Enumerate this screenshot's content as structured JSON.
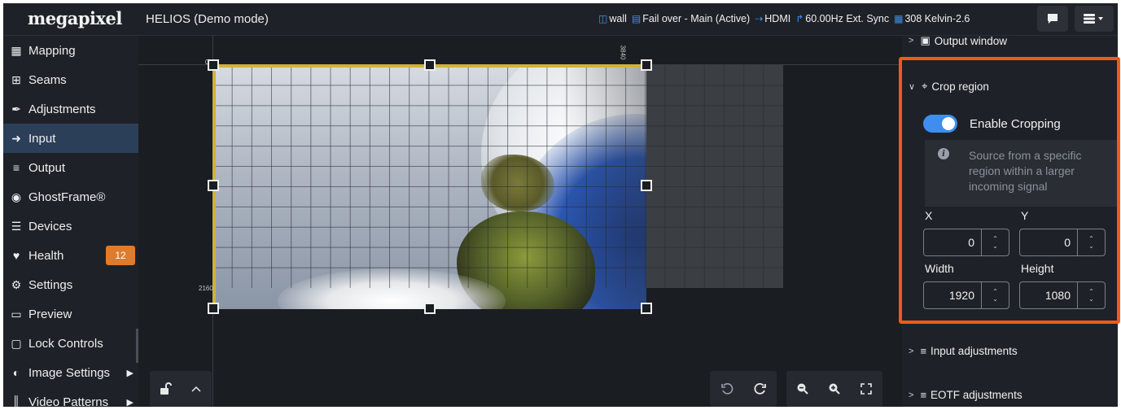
{
  "app": {
    "logo": "megapixel",
    "title": "HELIOS (Demo mode)"
  },
  "status_bar": [
    {
      "icon": "database-icon",
      "label": "wall"
    },
    {
      "icon": "server-icon",
      "label": "Fail over - Main (Active)"
    },
    {
      "icon": "input-arrow-icon",
      "label": "HDMI"
    },
    {
      "icon": "signal-pulse-icon",
      "label": "60.00Hz Ext. Sync"
    },
    {
      "icon": "grid-icon",
      "label": "308 Kelvin-2.6"
    }
  ],
  "toolbar_buttons": {
    "chat": "chat-icon",
    "database_menu": "database-menu-icon"
  },
  "sidebar": {
    "items": [
      {
        "label": "Mapping",
        "icon": "table-icon"
      },
      {
        "label": "Seams",
        "icon": "plus-square-icon"
      },
      {
        "label": "Adjustments",
        "icon": "brush-icon"
      },
      {
        "label": "Input",
        "icon": "sign-in-icon",
        "active": true
      },
      {
        "label": "Output",
        "icon": "sliders-icon"
      },
      {
        "label": "GhostFrame®",
        "icon": "ghostframe-icon"
      },
      {
        "label": "Devices",
        "icon": "list-icon"
      },
      {
        "label": "Health",
        "icon": "heart-pulse-icon",
        "badge": "12"
      },
      {
        "label": "Settings",
        "icon": "cogs-icon"
      },
      {
        "label": "Preview",
        "icon": "monitor-icon"
      },
      {
        "label": "Lock Controls",
        "icon": "unlock-icon"
      },
      {
        "label": "Image Settings",
        "icon": "contrast-icon",
        "submenu": true
      },
      {
        "label": "Video Patterns",
        "icon": "barcode-icon",
        "submenu": true
      }
    ]
  },
  "canvas": {
    "ruler_top_left": "0",
    "ruler_top_right": "3840",
    "ruler_left_bottom": "2160"
  },
  "panel": {
    "output_window": "Output window",
    "crop_region": "Crop region",
    "enable_cropping_label": "Enable Cropping",
    "enable_cropping_on": true,
    "info_text": "Source from a specific region within a larger incoming signal",
    "x_label": "X",
    "y_label": "Y",
    "x_value": "0",
    "y_value": "0",
    "width_label": "Width",
    "height_label": "Height",
    "width_value": "1920",
    "height_value": "1080",
    "input_adjustments": "Input adjustments",
    "eotf_adjustments": "EOTF adjustments"
  },
  "colors": {
    "accent": "#3e8ef0",
    "highlight": "#f05a1a",
    "badge": "#e07b2b",
    "active_nav": "#2c3f59",
    "crop_border": "#cfb23a"
  }
}
